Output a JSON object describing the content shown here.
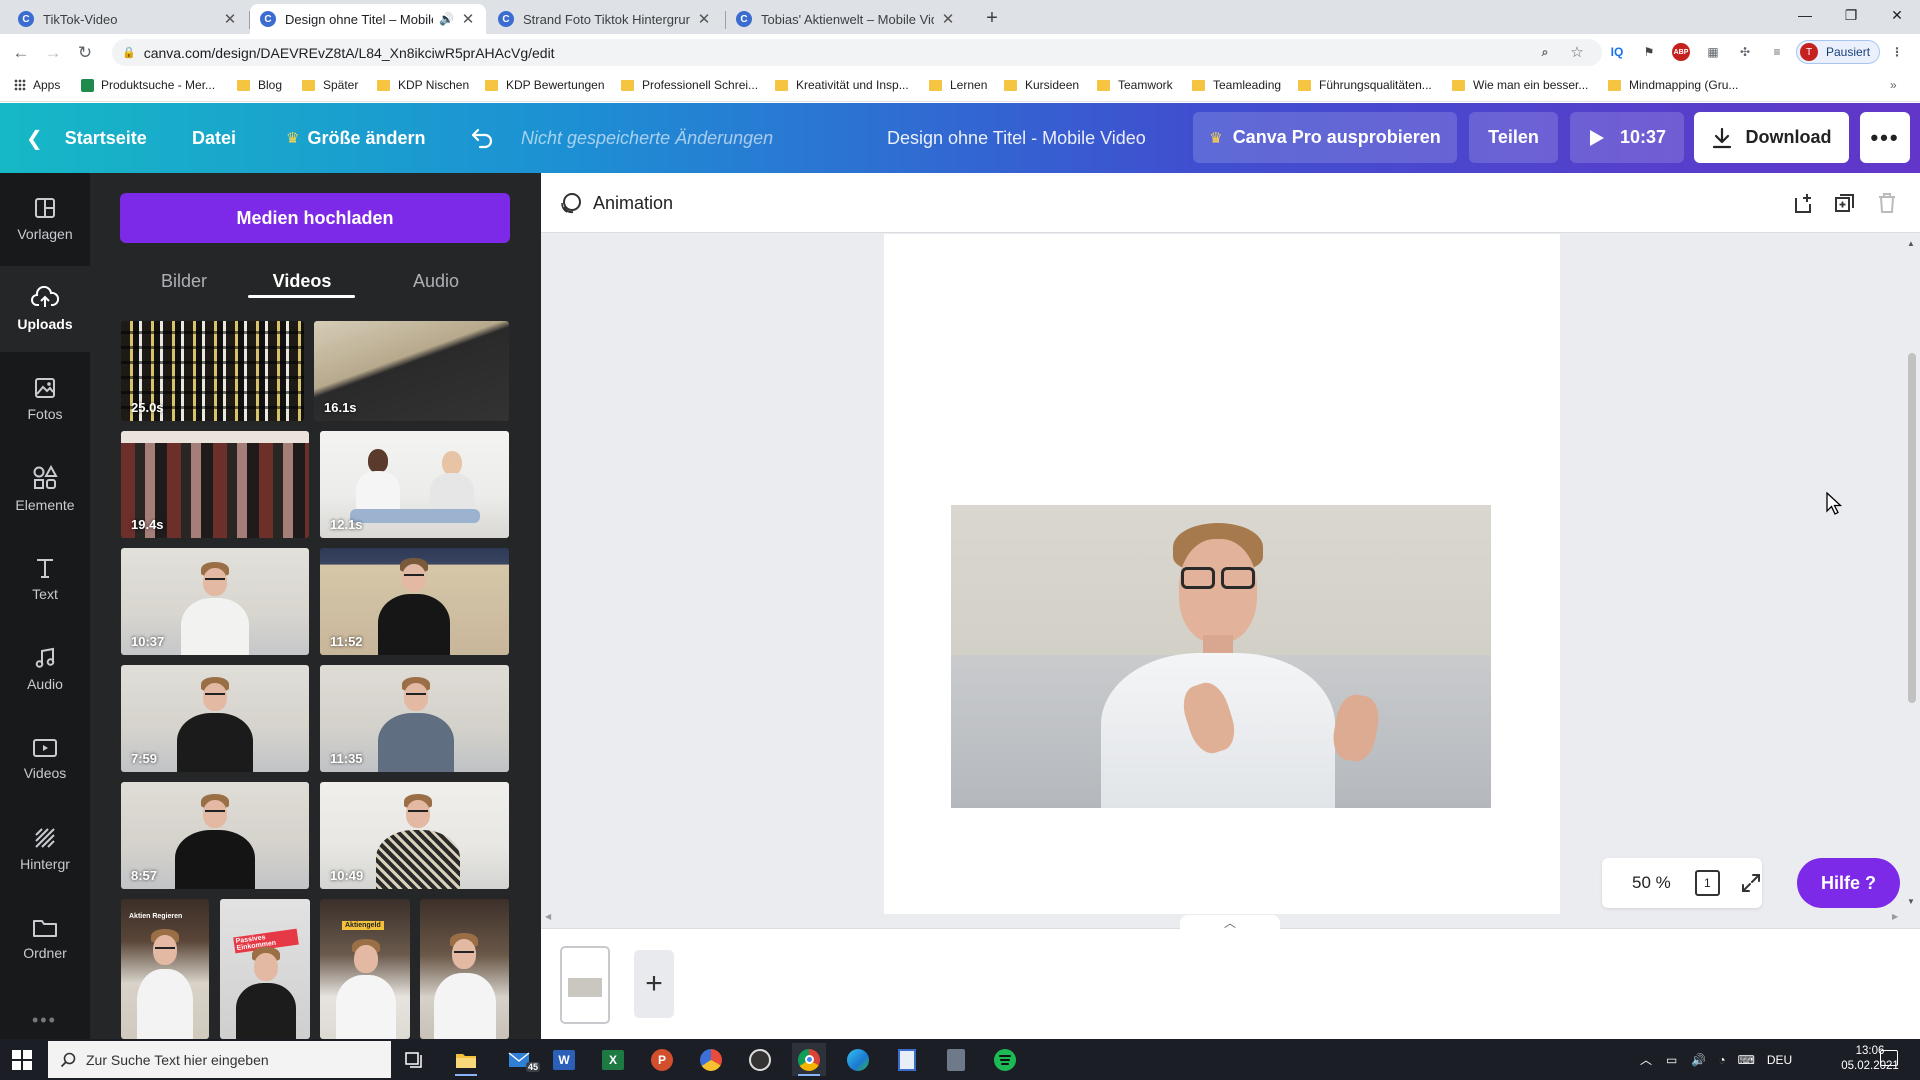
{
  "browser": {
    "tabs": [
      {
        "title": "TikTok-Video",
        "active": false
      },
      {
        "title": "Design ohne Titel – Mobile V",
        "active": true
      },
      {
        "title": "Strand Foto Tiktok Hintergrund -",
        "active": false
      },
      {
        "title": "Tobias' Aktienwelt – Mobile Vide",
        "active": false
      }
    ],
    "url": "canva.com/design/DAEVREvZ8tA/L84_Xn8ikciwR5prAHAcVg/edit",
    "profile_label": "Pausiert",
    "profile_initial": "T",
    "bookmarks": [
      "Apps",
      "Produktsuche - Mer...",
      "Blog",
      "Später",
      "KDP Nischen",
      "KDP Bewertungen",
      "Professionell Schrei...",
      "Kreativität und Insp...",
      "Lernen",
      "Kursideen",
      "Teamwork",
      "Teamleading",
      "Führungsqualitäten...",
      "Wie man ein besser...",
      "Mindmapping (Gru..."
    ]
  },
  "header": {
    "home": "Startseite",
    "file": "Datei",
    "resize": "Größe ändern",
    "unsaved": "Nicht gespeicherte Änderungen",
    "design_title": "Design ohne Titel - Mobile Video",
    "pro": "Canva Pro ausprobieren",
    "share": "Teilen",
    "play_time": "10:37",
    "download": "Download"
  },
  "rail": [
    {
      "label": "Vorlagen",
      "icon": "templates-icon"
    },
    {
      "label": "Uploads",
      "icon": "upload-cloud-icon"
    },
    {
      "label": "Fotos",
      "icon": "photo-icon"
    },
    {
      "label": "Elemente",
      "icon": "elements-icon"
    },
    {
      "label": "Text",
      "icon": "text-icon"
    },
    {
      "label": "Audio",
      "icon": "music-note-icon"
    },
    {
      "label": "Videos",
      "icon": "video-icon"
    },
    {
      "label": "Hintergr",
      "icon": "background-icon"
    },
    {
      "label": "Ordner",
      "icon": "folder-icon"
    }
  ],
  "panel": {
    "upload_button": "Medien hochladen",
    "tabs": [
      "Bilder",
      "Videos",
      "Audio"
    ],
    "active_tab": "Videos",
    "durations": [
      "25.0s",
      "16.1s",
      "19.4s",
      "12.1s",
      "10:37",
      "11:52",
      "7:59",
      "11:35",
      "8:57",
      "10:49"
    ],
    "short_thumb_captions": [
      "Aktien Regieren",
      "Passives Einkommen",
      "Aktiengeld"
    ]
  },
  "editor": {
    "animation": "Animation",
    "zoom": "50 %",
    "page_count": "1",
    "help": "Hilfe ?"
  },
  "taskbar": {
    "search_placeholder": "Zur Suche Text hier eingeben",
    "mail_badge": "45",
    "language": "DEU",
    "time": "13:06",
    "date": "05.02.2021"
  },
  "colors": {
    "canva_purple": "#7d2ae8",
    "panel_bg": "#252627",
    "rail_bg": "#18191b"
  }
}
